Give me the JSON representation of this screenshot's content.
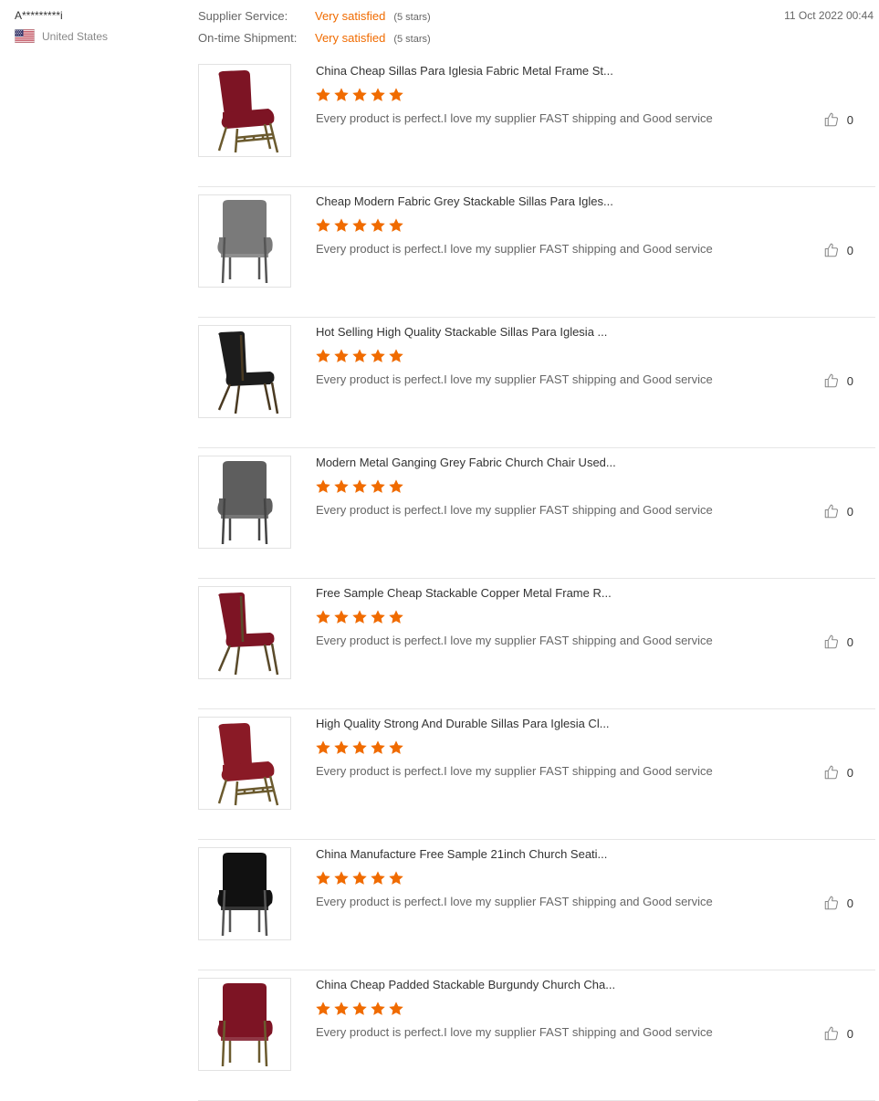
{
  "reviewer": {
    "name": "A*********i",
    "country": "United States",
    "flag_icon": "us-flag-icon"
  },
  "ratings": [
    {
      "label": "Supplier Service:",
      "value": "Very satisfied",
      "stars": "(5 stars)"
    },
    {
      "label": "On-time Shipment:",
      "value": "Very satisfied",
      "stars": "(5 stars)"
    }
  ],
  "date": "11 Oct 2022 00:44",
  "colors": {
    "accent": "#f06b00",
    "divider": "#e6e6e6"
  },
  "products": [
    {
      "title": "China Cheap Sillas Para Iglesia Fabric Metal Frame St...",
      "rating": 5,
      "comment": "Every product is perfect.I love my supplier FAST shipping and Good service",
      "likes": "0",
      "chair_color": "#7d1424",
      "frame_color": "#6b5a2e",
      "chair_style": "basket"
    },
    {
      "title": "Cheap Modern Fabric Grey Stackable Sillas Para Igles...",
      "rating": 5,
      "comment": "Every product is perfect.I love my supplier FAST shipping and Good service",
      "likes": "0",
      "chair_color": "#7a7a7a",
      "frame_color": "#555555",
      "chair_style": "front"
    },
    {
      "title": "Hot Selling High Quality Stackable Sillas Para Iglesia ...",
      "rating": 5,
      "comment": "Every product is perfect.I love my supplier FAST shipping and Good service",
      "likes": "0",
      "chair_color": "#1c1c1c",
      "frame_color": "#4a3a22",
      "chair_style": "side"
    },
    {
      "title": "Modern Metal Ganging Grey Fabric Church Chair Used...",
      "rating": 5,
      "comment": "Every product is perfect.I love my supplier FAST shipping and Good service",
      "likes": "0",
      "chair_color": "#5e5e5e",
      "frame_color": "#444444",
      "chair_style": "front"
    },
    {
      "title": "Free Sample Cheap Stackable Copper Metal Frame R...",
      "rating": 5,
      "comment": "Every product is perfect.I love my supplier FAST shipping and Good service",
      "likes": "0",
      "chair_color": "#7d1424",
      "frame_color": "#5a4a2a",
      "chair_style": "side"
    },
    {
      "title": "High Quality Strong And Durable Sillas Para Iglesia Cl...",
      "rating": 5,
      "comment": "Every product is perfect.I love my supplier FAST shipping and Good service",
      "likes": "0",
      "chair_color": "#8a1a26",
      "frame_color": "#6b5a2e",
      "chair_style": "basket"
    },
    {
      "title": "China Manufacture Free Sample 21inch Church Seati...",
      "rating": 5,
      "comment": "Every product is perfect.I love my supplier FAST shipping and Good service",
      "likes": "0",
      "chair_color": "#111111",
      "frame_color": "#555555",
      "chair_style": "front"
    },
    {
      "title": "China Cheap Padded Stackable Burgundy Church Cha...",
      "rating": 5,
      "comment": "Every product is perfect.I love my supplier FAST shipping and Good service",
      "likes": "0",
      "chair_color": "#7d1424",
      "frame_color": "#6b5a2e",
      "chair_style": "front"
    }
  ]
}
